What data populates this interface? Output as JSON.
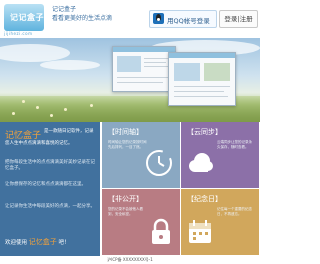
{
  "header": {
    "logo_text": "记记盒子",
    "logo_sub": "jijihezi.com",
    "slogan_line1": "记记盒子",
    "slogan_line2": "看看更美好的生活点滴",
    "qq_login_label": "用QQ帐号登录",
    "login_register_label": "登录|注册"
  },
  "intro": {
    "title": "记忆盒子",
    "lead": "是一款随日记软件，记录",
    "lead2": "您人生中点点滴滴和喜悦的记忆。",
    "p1": "把你每段生活中的点点滴滴美好美妙记录在记忆盒子。",
    "p2": "让你想保存的记忆和点点滴滴都在这里。",
    "p3": "让记录你生活中每段美好的点滴，一起分享。",
    "footer_prefix": "欢迎使用",
    "footer_name": "记忆盒子",
    "footer_suffix": "吧！"
  },
  "tiles": [
    {
      "title": "【时间轴】",
      "text": "时间轴让您的记录按时间先后排列，一目了然。",
      "color": "#8aa8c2",
      "icon": "clock-icon"
    },
    {
      "title": "【云同步】",
      "text": "云端同步让您的记录永久保存，随时查看。",
      "color": "#8c70a8",
      "icon": "cloud-icon"
    },
    {
      "title": "【非公开】",
      "text": "您的记录不会被他人看到，安全私密。",
      "color": "#b87c83",
      "icon": "lock-icon"
    },
    {
      "title": "【纪念日】",
      "text": "记住每一个重要的纪念日，不再遗忘。",
      "color": "#d1a75c",
      "icon": "calendar-icon"
    }
  ],
  "footer": {
    "icp": "沪ICP备 XXXXXXXX号-1"
  },
  "colors": {
    "intro_bg": "#41719e",
    "accent_orange": "#f4a23a"
  }
}
